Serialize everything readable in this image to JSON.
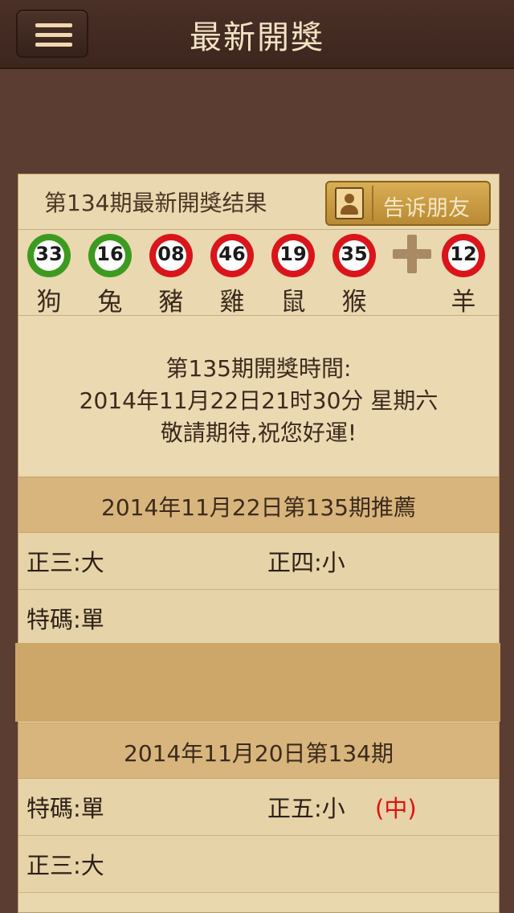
{
  "nav": {
    "title": "最新開獎",
    "menu_icon": "hamburger-menu-icon"
  },
  "latest": {
    "title": "第134期最新開獎结果",
    "share_button": "告诉朋友",
    "share_icon": "contacts-book-icon",
    "balls": [
      {
        "number": "33",
        "zodiac": "狗",
        "color": "#3c9b1e"
      },
      {
        "number": "16",
        "zodiac": "兔",
        "color": "#3c9b1e"
      },
      {
        "number": "08",
        "zodiac": "豬",
        "color": "#d9151b"
      },
      {
        "number": "46",
        "zodiac": "雞",
        "color": "#d9151b"
      },
      {
        "number": "19",
        "zodiac": "鼠",
        "color": "#d9151b"
      },
      {
        "number": "35",
        "zodiac": "猴",
        "color": "#d9151b"
      }
    ],
    "special_ball": {
      "number": "12",
      "zodiac": "羊",
      "color": "#d9151b"
    }
  },
  "next_draw": {
    "line1": "第135期開獎時間:",
    "line2": "2014年11月22日21时30分 星期六",
    "line3": "敬請期待,祝您好運!"
  },
  "recommend": {
    "title": "2014年11月22日第135期推薦",
    "rows": [
      {
        "left": "正三:大",
        "right": "正四:小"
      },
      {
        "left": "特碼:單",
        "right": ""
      }
    ]
  },
  "previous": {
    "title": "2014年11月20日第134期",
    "rows": [
      {
        "left": "特碼:單",
        "right": "正五:小",
        "hit": "(中)"
      },
      {
        "left": "正三:大",
        "right": "",
        "hit": ""
      }
    ]
  }
}
